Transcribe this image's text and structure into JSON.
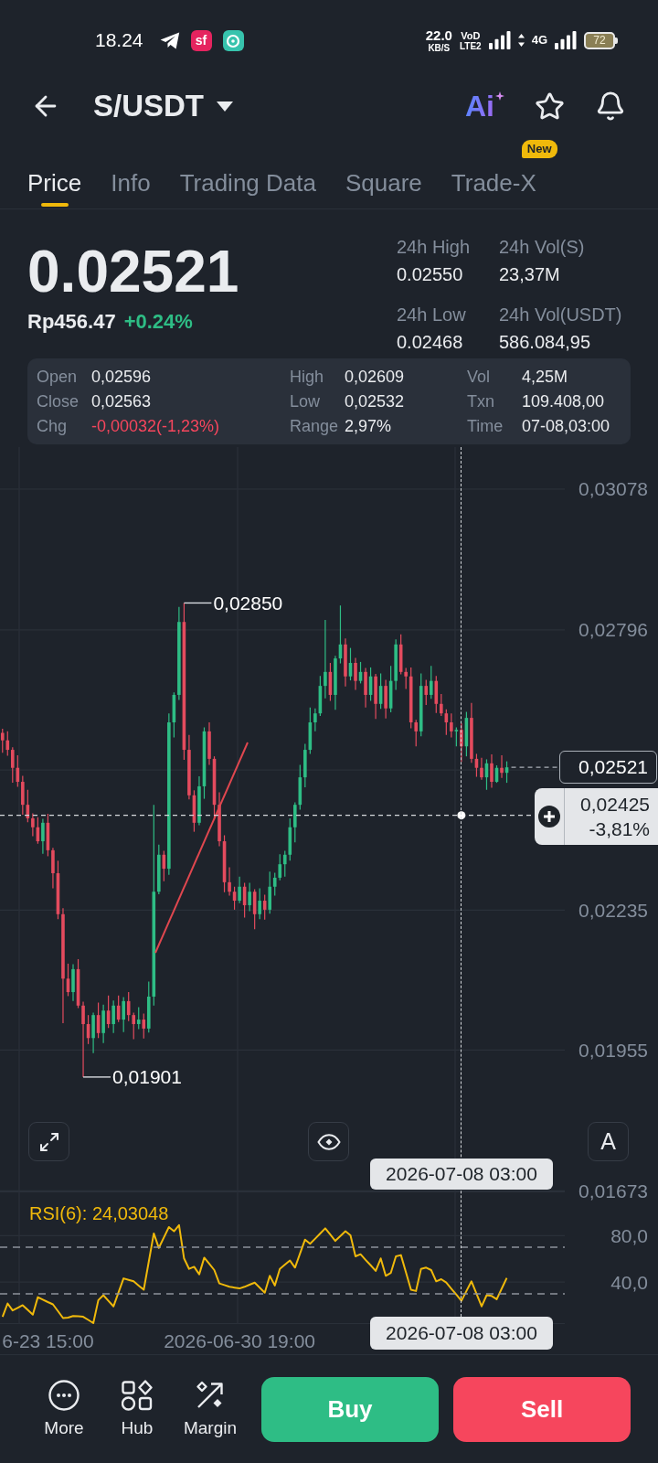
{
  "status_bar": {
    "time": "18.24",
    "app_badge": "sf",
    "net_speed": "22.0",
    "net_speed_unit": "KB/S",
    "volte_top": "VoD",
    "volte_bottom": "LTE2",
    "network": "4G",
    "battery": "72"
  },
  "header": {
    "pair": "S/USDT",
    "ai_label": "Ai"
  },
  "tabs": [
    {
      "label": "Price",
      "selected": true
    },
    {
      "label": "Info",
      "selected": false
    },
    {
      "label": "Trading Data",
      "selected": false
    },
    {
      "label": "Square",
      "selected": false
    },
    {
      "label": "Trade-X",
      "selected": false,
      "badge": "New"
    }
  ],
  "ticker": {
    "last_price": "0.02521",
    "fiat_price": "Rp456.47",
    "change": {
      "text": "+0.24%",
      "color": "#2ebd85"
    },
    "stats": [
      {
        "label": "24h High",
        "value": "0.02550"
      },
      {
        "label": "24h Vol(S)",
        "value": "23,37M"
      },
      {
        "label": "24h Low",
        "value": "0.02468"
      },
      {
        "label": "24h Vol(USDT)",
        "value": "586.084,95"
      }
    ]
  },
  "ohlc": {
    "columns": [
      [
        {
          "label": "Open",
          "value": "0,02596",
          "color": "#eaecef"
        },
        {
          "label": "Close",
          "value": "0,02563",
          "color": "#eaecef"
        },
        {
          "label": "Chg",
          "value": "-0,00032(-1,23%)",
          "color": "#f6465d"
        }
      ],
      [
        {
          "label": "High",
          "value": "0,02609",
          "color": "#eaecef"
        },
        {
          "label": "Low",
          "value": "0,02532",
          "color": "#eaecef"
        },
        {
          "label": "Range",
          "value": "2,97%",
          "color": "#eaecef"
        }
      ],
      [
        {
          "label": "Vol",
          "value": "4,25M",
          "color": "#eaecef"
        },
        {
          "label": "Txn",
          "value": "109.408,00",
          "color": "#eaecef"
        },
        {
          "label": "Time",
          "value": "07-08,03:00",
          "color": "#eaecef"
        }
      ]
    ]
  },
  "price_chart": {
    "chart_data": {
      "type": "candlestick",
      "grid": true,
      "categories": [
        null,
        null,
        null,
        null,
        null,
        null,
        null,
        null,
        null,
        null,
        null,
        null,
        null,
        null,
        null,
        null,
        null,
        null,
        null,
        null,
        null,
        null,
        null,
        null,
        null,
        null,
        null,
        null,
        null,
        null,
        null,
        null,
        null,
        null,
        null,
        null,
        null,
        null,
        null,
        null,
        null,
        null,
        null,
        null,
        null,
        null,
        null,
        null,
        null,
        null,
        null,
        null,
        null,
        null,
        null,
        null,
        null,
        null,
        null,
        null,
        null,
        null,
        null,
        null,
        null,
        null,
        null,
        null,
        null,
        null,
        null,
        null,
        null,
        null,
        null,
        null,
        null,
        null,
        null,
        null,
        null,
        null,
        null,
        null,
        null,
        null,
        null,
        null,
        null,
        null,
        null,
        null,
        null,
        null,
        null,
        null,
        null,
        null,
        null,
        null,
        null,
        null,
        null,
        null,
        null,
        null,
        null,
        null,
        null,
        null,
        null,
        null
      ],
      "ohlc": [
        [
          0.0259,
          0.02598,
          0.0255,
          0.02575
        ],
        [
          0.02575,
          0.02593,
          0.02544,
          0.02556
        ],
        [
          0.02556,
          0.02561,
          0.0249,
          0.0252
        ],
        [
          0.0252,
          0.02545,
          0.02482,
          0.02492
        ],
        [
          0.02492,
          0.02504,
          0.02426,
          0.02446
        ],
        [
          0.02446,
          0.02476,
          0.02411,
          0.02419
        ],
        [
          0.02419,
          0.02429,
          0.02383,
          0.02401
        ],
        [
          0.02401,
          0.02421,
          0.02368,
          0.02373
        ],
        [
          0.02373,
          0.02418,
          0.02348,
          0.0241
        ],
        [
          0.0241,
          0.02428,
          0.02343,
          0.02355
        ],
        [
          0.02355,
          0.0236,
          0.02279,
          0.02309
        ],
        [
          0.02309,
          0.02334,
          0.02217,
          0.02227
        ],
        [
          0.02227,
          0.02239,
          0.02009,
          0.02098
        ],
        [
          0.02098,
          0.02128,
          0.02063,
          0.02071
        ],
        [
          0.02071,
          0.02127,
          0.02053,
          0.02117
        ],
        [
          0.02117,
          0.02137,
          0.02039,
          0.02044
        ],
        [
          0.02044,
          0.02052,
          0.01901,
          0.02007
        ],
        [
          0.02007,
          0.02025,
          0.01967,
          0.01979
        ],
        [
          0.01979,
          0.0203,
          0.01949,
          0.02025
        ],
        [
          0.02025,
          0.0205,
          0.01979,
          0.01989
        ],
        [
          0.01989,
          0.02046,
          0.01969,
          0.02034
        ],
        [
          0.02034,
          0.02064,
          0.01999,
          0.02007
        ],
        [
          0.02007,
          0.02054,
          0.01989,
          0.02044
        ],
        [
          0.02044,
          0.02064,
          0.02011,
          0.02016
        ],
        [
          0.02016,
          0.02061,
          0.01991,
          0.02053
        ],
        [
          0.02053,
          0.02071,
          0.02013,
          0.02025
        ],
        [
          0.02025,
          0.0203,
          0.01977,
          0.02007
        ],
        [
          0.02007,
          0.02041,
          0.01997,
          0.02016
        ],
        [
          0.02016,
          0.02028,
          0.01978,
          0.01998
        ],
        [
          0.01998,
          0.02092,
          0.0199,
          0.02062
        ],
        [
          0.02062,
          0.02446,
          0.02044,
          0.02272
        ],
        [
          0.02272,
          0.02366,
          0.02267,
          0.02346
        ],
        [
          0.02346,
          0.02354,
          0.02293,
          0.02318
        ],
        [
          0.02318,
          0.02629,
          0.02306,
          0.02611
        ],
        [
          0.02611,
          0.02671,
          0.02581,
          0.02666
        ],
        [
          0.02666,
          0.02842,
          0.02656,
          0.02812
        ],
        [
          0.02812,
          0.0285,
          0.02536,
          0.02556
        ],
        [
          0.02556,
          0.02586,
          0.02457,
          0.02465
        ],
        [
          0.02465,
          0.02475,
          0.02392,
          0.0241
        ],
        [
          0.0241,
          0.02503,
          0.02405,
          0.02483
        ],
        [
          0.02483,
          0.02601,
          0.02458,
          0.02593
        ],
        [
          0.02593,
          0.02611,
          0.02526,
          0.02538
        ],
        [
          0.02538,
          0.02543,
          0.02416,
          0.02446
        ],
        [
          0.02446,
          0.02471,
          0.02363,
          0.02373
        ],
        [
          0.02373,
          0.02385,
          0.02271,
          0.02291
        ],
        [
          0.02291,
          0.02321,
          0.02264,
          0.02272
        ],
        [
          0.02272,
          0.02282,
          0.02236,
          0.02254
        ],
        [
          0.02254,
          0.02302,
          0.02249,
          0.02282
        ],
        [
          0.02282,
          0.0229,
          0.0222,
          0.02245
        ],
        [
          0.02245,
          0.0229,
          0.02233,
          0.02272
        ],
        [
          0.02272,
          0.02277,
          0.02197,
          0.02227
        ],
        [
          0.02227,
          0.02279,
          0.02217,
          0.02254
        ],
        [
          0.02254,
          0.02266,
          0.02216,
          0.02236
        ],
        [
          0.02236,
          0.02312,
          0.02228,
          0.02282
        ],
        [
          0.02282,
          0.0231,
          0.02264,
          0.023
        ],
        [
          0.023,
          0.02347,
          0.02295,
          0.02327
        ],
        [
          0.02327,
          0.02354,
          0.02302,
          0.02346
        ],
        [
          0.02346,
          0.02419,
          0.02334,
          0.02401
        ],
        [
          0.02401,
          0.02451,
          0.02371,
          0.02446
        ],
        [
          0.02446,
          0.02526,
          0.02436,
          0.02501
        ],
        [
          0.02501,
          0.02568,
          0.02481,
          0.02556
        ],
        [
          0.02556,
          0.02641,
          0.02548,
          0.02611
        ],
        [
          0.02611,
          0.02639,
          0.02593,
          0.02629
        ],
        [
          0.02629,
          0.02704,
          0.02624,
          0.02684
        ],
        [
          0.02684,
          0.02816,
          0.02659,
          0.02712
        ],
        [
          0.02712,
          0.0273,
          0.02654,
          0.02666
        ],
        [
          0.02666,
          0.02744,
          0.02636,
          0.02739
        ],
        [
          0.02739,
          0.02845,
          0.02729,
          0.02767
        ],
        [
          0.02767,
          0.02779,
          0.02683,
          0.02703
        ],
        [
          0.02703,
          0.0276,
          0.02695,
          0.0273
        ],
        [
          0.0273,
          0.0274,
          0.02676,
          0.02694
        ],
        [
          0.02694,
          0.02732,
          0.02689,
          0.02712
        ],
        [
          0.02712,
          0.0272,
          0.02641,
          0.02666
        ],
        [
          0.02666,
          0.02721,
          0.02654,
          0.02703
        ],
        [
          0.02703,
          0.02708,
          0.02618,
          0.02648
        ],
        [
          0.02648,
          0.02709,
          0.02638,
          0.02684
        ],
        [
          0.02684,
          0.02696,
          0.02619,
          0.02639
        ],
        [
          0.02639,
          0.02724,
          0.02631,
          0.02694
        ],
        [
          0.02694,
          0.02777,
          0.02676,
          0.02767
        ],
        [
          0.02767,
          0.02787,
          0.02707,
          0.02712
        ],
        [
          0.02712,
          0.0272,
          0.02678,
          0.02703
        ],
        [
          0.02703,
          0.02721,
          0.02599,
          0.02611
        ],
        [
          0.02611,
          0.02616,
          0.02563,
          0.02593
        ],
        [
          0.02593,
          0.02709,
          0.02583,
          0.02684
        ],
        [
          0.02684,
          0.02696,
          0.02646,
          0.02666
        ],
        [
          0.02666,
          0.02724,
          0.02658,
          0.02694
        ],
        [
          0.02694,
          0.02704,
          0.0263,
          0.02648
        ],
        [
          0.02648,
          0.02668,
          0.02624,
          0.02629
        ],
        [
          0.02629,
          0.02637,
          0.02586,
          0.02611
        ],
        [
          0.02611,
          0.02629,
          0.02581,
          0.02593
        ],
        [
          0.02593,
          0.02601,
          0.02563,
          0.02596
        ],
        [
          0.02596,
          0.02609,
          0.02532,
          0.02563
        ],
        [
          0.02563,
          0.02632,
          0.02543,
          0.0262
        ],
        [
          0.0262,
          0.0265,
          0.0253,
          0.02538
        ],
        [
          0.02538,
          0.02548,
          0.02502,
          0.0252
        ],
        [
          0.0252,
          0.0254,
          0.02496,
          0.02501
        ],
        [
          0.02501,
          0.02537,
          0.02476,
          0.02529
        ],
        [
          0.02529,
          0.02547,
          0.0248,
          0.02492
        ],
        [
          0.02492,
          0.02525,
          0.0249,
          0.0252
        ],
        [
          0.0252,
          0.02545,
          0.025,
          0.0251
        ],
        [
          0.0251,
          0.02533,
          0.0249,
          0.02521
        ],
        null,
        null,
        null,
        null,
        null,
        null,
        null,
        null,
        null,
        null,
        null
      ],
      "ylim": [
        0.01672,
        0.03162
      ],
      "yticks": [
        {
          "value": 0.03078,
          "label": "0,03078"
        },
        {
          "value": 0.02796,
          "label": "0,02796"
        },
        {
          "value": 0.02235,
          "label": "0,02235"
        },
        {
          "value": 0.01955,
          "label": "0,01955"
        },
        {
          "value": 0.01673,
          "label": "0,01673"
        }
      ],
      "annotations": [
        "0,02850",
        "0,01901"
      ]
    },
    "last_price": "0,02521",
    "crosshair": {
      "price": "0,02425",
      "change": "-3,81%",
      "time": "2026-07-08 03:00"
    },
    "tools": [
      {
        "kind": "expand"
      },
      {
        "kind": "visibility"
      },
      {
        "kind": "text",
        "label": "A"
      }
    ]
  },
  "rsi": {
    "label": "RSI(6): 24,03048",
    "crosshair_time": "2026-07-08 03:00",
    "chart_data": {
      "type": "line",
      "grid": true,
      "categories": [
        null,
        null,
        null,
        null,
        null,
        null,
        null,
        null,
        null,
        "6-23 15:00",
        null,
        null,
        null,
        null,
        null,
        null,
        null,
        null,
        null,
        null,
        null,
        null,
        null,
        null,
        null,
        null,
        null,
        null,
        null,
        null,
        null,
        null,
        null,
        null,
        null,
        null,
        null,
        null,
        null,
        null,
        null,
        null,
        null,
        null,
        null,
        null,
        null,
        "2026-06-30 19:00",
        null,
        null,
        null,
        null,
        null,
        null,
        null,
        null,
        null,
        null,
        null,
        null,
        null,
        null,
        null,
        null,
        null,
        null,
        null,
        null,
        null,
        null,
        null,
        null,
        null,
        null,
        null,
        null,
        null,
        null,
        null,
        null,
        null,
        null,
        null,
        null,
        null,
        null,
        null,
        null,
        null,
        null,
        null,
        null,
        null,
        null,
        null,
        null,
        null,
        null,
        null,
        null,
        null,
        null,
        null,
        null,
        null,
        null,
        null,
        null,
        null,
        null,
        null,
        null
      ],
      "series": [
        {
          "color": "#f0b90b",
          "values": [
            10.2,
            21.7,
            15.6,
            17.9,
            20.2,
            16.1,
            12.0,
            27.1,
            25.0,
            22.9,
            20.9,
            15.0,
            9.1,
            9.5,
            10.9,
            10.6,
            10.2,
            7.5,
            4.8,
            24.5,
            28.8,
            24.0,
            19.2,
            31.2,
            43.2,
            42.0,
            40.7,
            37.1,
            33.5,
            57.7,
            81.9,
            69.4,
            78.4,
            87.3,
            83.7,
            89.1,
            60.4,
            51.4,
            53.2,
            46.8,
            61.1,
            55.8,
            50.4,
            38.9,
            37.5,
            36.0,
            35.3,
            34.6,
            36.0,
            37.8,
            39.6,
            35.3,
            31.0,
            45.4,
            37.1,
            51.4,
            55.0,
            58.6,
            52.5,
            64.6,
            76.6,
            73.0,
            77.4,
            81.8,
            86.2,
            80.9,
            75.5,
            79.6,
            83.7,
            80.2,
            62.2,
            64.0,
            59.2,
            54.5,
            49.7,
            60.4,
            45.4,
            47.9,
            62.2,
            63.3,
            48.4,
            33.5,
            32.4,
            51.4,
            52.5,
            50.4,
            40.7,
            42.5,
            39.6,
            34.4,
            29.2,
            24.0,
            32.4,
            40.7,
            30.0,
            19.2,
            28.8,
            28.1,
            25.3,
            34.5,
            43.6,
            null,
            null,
            null,
            null,
            null,
            null,
            null,
            null,
            null,
            null,
            null
          ]
        }
      ],
      "ylim": [
        4,
        118
      ],
      "yticks": [
        {
          "value": 80,
          "label": "80,0"
        },
        {
          "value": 40,
          "label": "40,0"
        }
      ]
    }
  },
  "bottom_bar": {
    "nav": [
      {
        "kind": "more",
        "label": "More"
      },
      {
        "kind": "hub",
        "label": "Hub"
      },
      {
        "kind": "margin",
        "label": "Margin"
      }
    ],
    "actions": [
      {
        "kind": "buy",
        "label": "Buy"
      },
      {
        "kind": "sell",
        "label": "Sell"
      }
    ]
  }
}
